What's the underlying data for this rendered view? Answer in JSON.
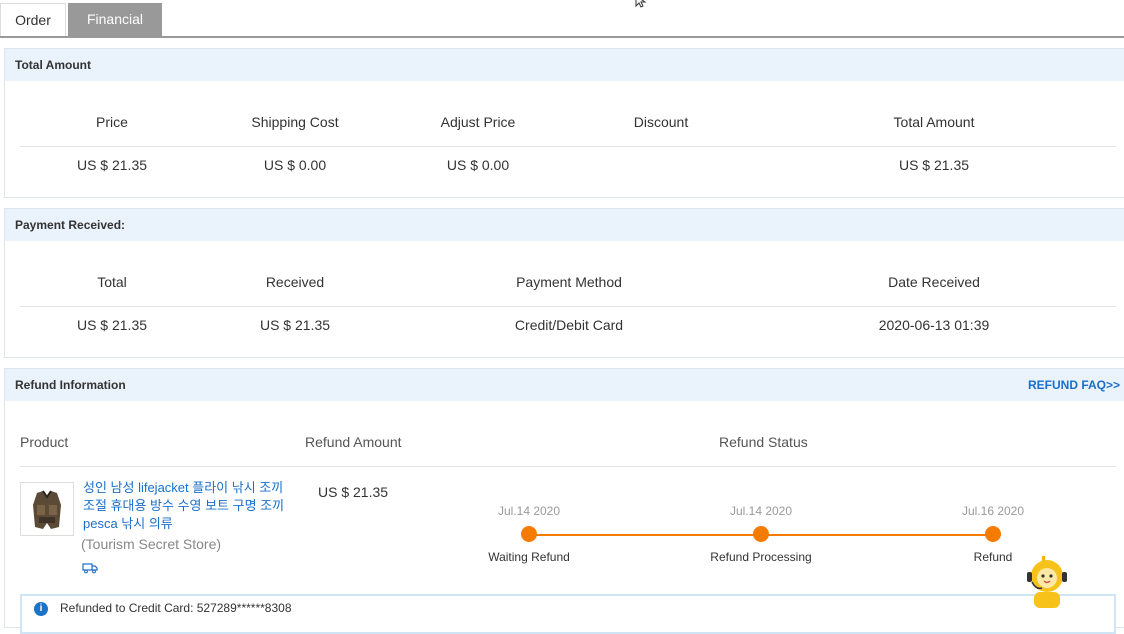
{
  "tabs": [
    {
      "label": "Order",
      "active": false
    },
    {
      "label": "Financial",
      "active": true
    }
  ],
  "total_amount": {
    "title": "Total Amount",
    "headers": [
      "Price",
      "Shipping Cost",
      "Adjust Price",
      "Discount",
      "Total Amount"
    ],
    "values": [
      "US $ 21.35",
      "US $ 0.00",
      "US $ 0.00",
      "",
      "US $ 21.35"
    ]
  },
  "payment": {
    "title": "Payment Received:",
    "headers": [
      "Total",
      "Received",
      "Payment Method",
      "Date Received"
    ],
    "values": [
      "US $ 21.35",
      "US $ 21.35",
      "Credit/Debit Card",
      "2020-06-13 01:39"
    ]
  },
  "refund": {
    "title": "Refund Information",
    "faq_link": "REFUND FAQ>>",
    "headers": {
      "product": "Product",
      "amount": "Refund Amount",
      "status": "Refund Status"
    },
    "product_title": "성인 남성 lifejacket 플라이 낚시 조끼 조절 휴대용 방수 수영 보트 구명 조끼 pesca 낚시 의류",
    "store": "(Tourism Secret Store)",
    "amount": "US $ 21.35",
    "timeline": [
      {
        "date": "Jul.14 2020",
        "label": "Waiting Refund"
      },
      {
        "date": "Jul.14 2020",
        "label": "Refund Processing"
      },
      {
        "date": "Jul.16 2020",
        "label": "Refund"
      }
    ],
    "notice": "Refunded to Credit Card: 527289******8308"
  },
  "colors": {
    "accent": "#f57c00",
    "link": "#1a6fc9",
    "header_bg": "#eaf2fb",
    "tab_active": "#999999"
  },
  "icons": [
    "cursor-icon",
    "shipping-icon",
    "info-icon",
    "mascot-icon"
  ]
}
